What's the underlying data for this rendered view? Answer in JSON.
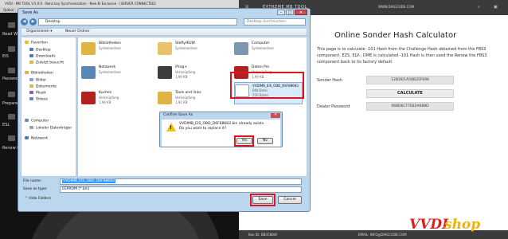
{
  "background_app": {
    "title": "VVDI - MB TOOL V.5.0.0 - Benz key Synchronization - New KI Exclusive - [SERVER CONNECTED]",
    "menu": "Option",
    "side_items": [
      "Read Write",
      "EIS",
      "Password",
      "Prepare",
      "ESL",
      "Renew EIS"
    ]
  },
  "webpage": {
    "brand": "EXTREME MB TOOL",
    "site": "WWW.DIAGCODE.COM",
    "heading": "Online Sonder Hash Calculator",
    "description": "This page is to calculate -101 Hash from the Challenge Hash obtained from the FBS3 component. EZS, ELV-, DME is calculated -101 Hash is then used the Renew the FBS3 component back to its factory default",
    "sonder_hash_label": "Sonder Hash",
    "sonder_hash_value": "12B28/1A58B35F696",
    "calculate_label": "CALCULATE",
    "dealer_password_label": "Dealer Password",
    "dealer_password_value": "068D6CF7E82A688D",
    "footer_left": "Box ID: DB3C884F",
    "footer_right": "EMAIL: INFO@DIAGCODE.COM",
    "watermark_left": "VVDI",
    "watermark_right": "shop"
  },
  "save_dialog": {
    "title": "Save As",
    "address": "Desktop",
    "search_placeholder": "Desktop durchsuchen",
    "toolbar": {
      "organize": "Organisieren ▾",
      "new_folder": "Neuer Ordner"
    },
    "nav": {
      "favorites": "Favoriten",
      "fav_items": [
        "Desktop",
        "Downloads",
        "Zuletzt besucht"
      ],
      "libraries": "Bibliotheken",
      "lib_items": [
        "Bilder",
        "Dokumente",
        "Musik",
        "Videos"
      ],
      "computer": "Computer",
      "computer_items": [
        "Lokaler Datenträger"
      ],
      "network": "Netzwerk"
    },
    "files": [
      {
        "name": "Bibliotheken",
        "sub1": "Systemordner",
        "sub2": ""
      },
      {
        "name": "Stefly/KUW",
        "sub1": "Systemordner",
        "sub2": ""
      },
      {
        "name": "Computer",
        "sub1": "Systemordner",
        "sub2": ""
      },
      {
        "name": "Netzwerk",
        "sub1": "Systemordner",
        "sub2": ""
      },
      {
        "name": "iProg+",
        "sub1": "Verknüpfung",
        "sub2": "1,90 KB"
      },
      {
        "name": "Daten Pro",
        "sub1": "Verknüpfung",
        "sub2": "1,90 KB"
      },
      {
        "name": "Kuchen",
        "sub1": "Verknüpfung",
        "sub2": "1,94 KB"
      },
      {
        "name": "Tools and links",
        "sub1": "Verknüpfung",
        "sub2": "1,91 KB"
      },
      {
        "name": "VVDIMB_EIS_OBD_D6F88683",
        "sub1": "BIN-Datei",
        "sub2": "256 Bytes"
      }
    ],
    "filename_label": "File name:",
    "filename_value": "VVDIMB_EIS_OBD_D6F88683",
    "savetype_label": "Save as type:",
    "savetype_value": "EEPROM (*.bin)",
    "hide_folders": "Hide Folders",
    "save_label": "Save",
    "cancel_label": "Cancel"
  },
  "confirm_dialog": {
    "title": "Confirm Save As",
    "message1": "VVDIMB_EIS_OBD_D6F88683.bin already exists.",
    "message2": "Do you want to replace it?",
    "yes_label": "Yes",
    "no_label": "No"
  },
  "colors": {
    "highlight_red": "#e0141e",
    "selection_blue": "#3399ff",
    "dialog_frame": "#bcd6ee"
  }
}
